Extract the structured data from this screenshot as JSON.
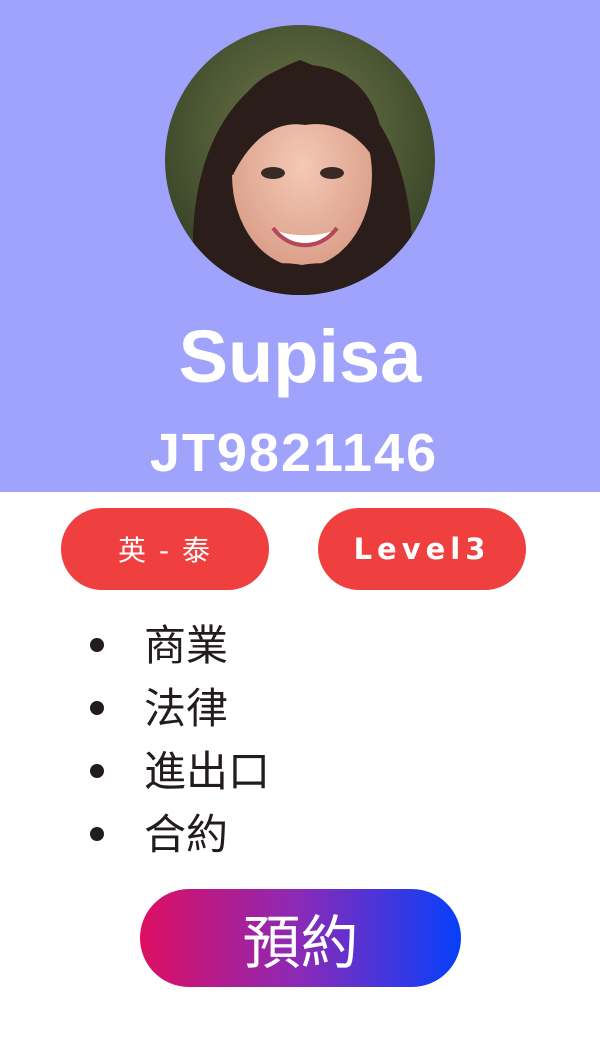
{
  "profile": {
    "name": "Supisa",
    "code": "JT9821146",
    "language_pair": "英 - 泰",
    "level": "Level3"
  },
  "topics": [
    "商業",
    "法律",
    "進出口",
    "合約"
  ],
  "actions": {
    "book_label": "預約"
  },
  "colors": {
    "header_bg": "#9fa3fb",
    "pill_bg": "#ef3f3f",
    "button_gradient_start": "#dd0e62",
    "button_gradient_end": "#0540fb",
    "text_dark": "#231c1c"
  }
}
